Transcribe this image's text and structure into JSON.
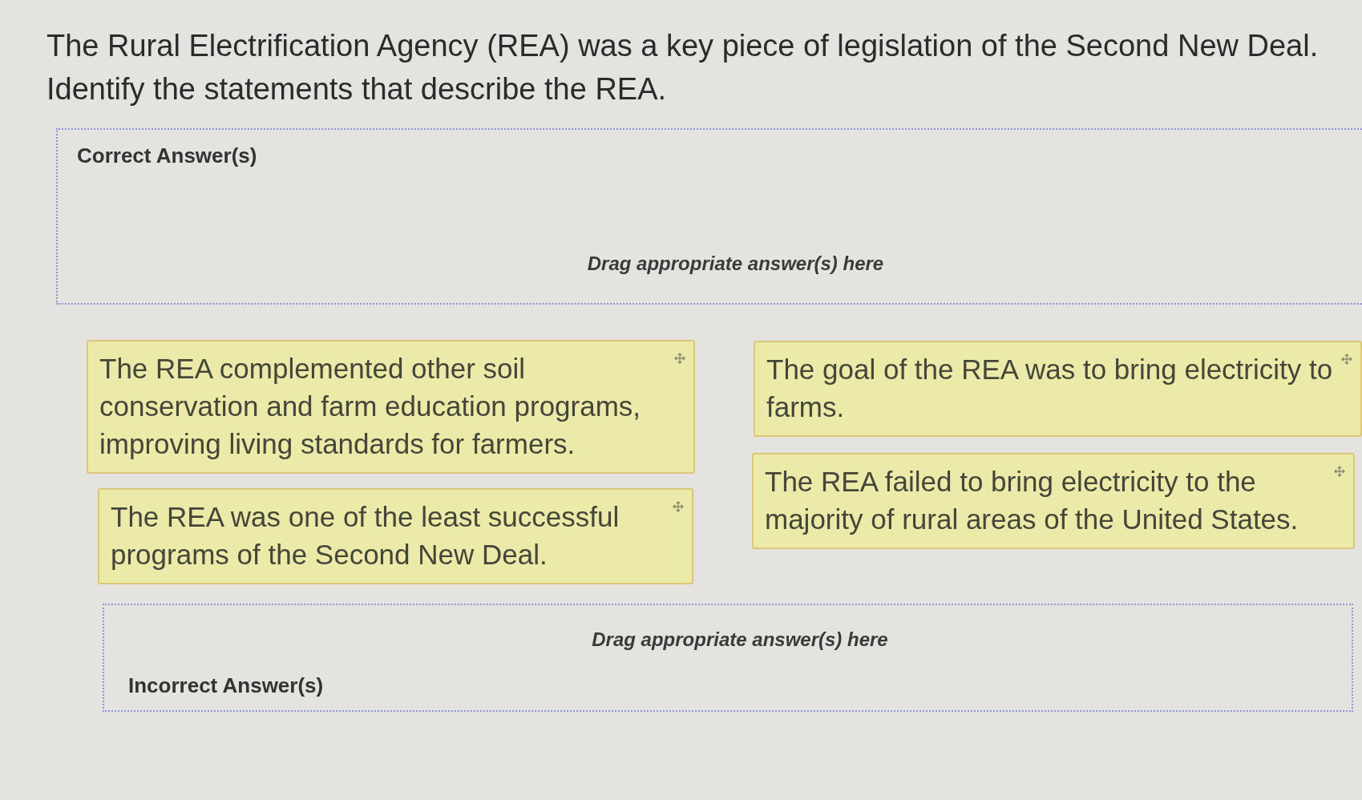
{
  "question": {
    "lines": [
      "The Rural Electrification Agency (REA) was a key piece of legislation of the Second New Deal.",
      "Identify the statements that describe the REA."
    ]
  },
  "correct_zone": {
    "label": "Correct Answer(s)",
    "hint": "Drag appropriate answer(s) here"
  },
  "card_columns": [
    {
      "cards": [
        {
          "text": "The REA complemented other soil conservation and farm education programs, improving living standards for farmers."
        },
        {
          "text": "The REA was one of the least successful programs of the Second New Deal."
        }
      ]
    },
    {
      "cards": [
        {
          "text": "The goal of the REA was to bring electricity to farms."
        },
        {
          "text": "The REA failed to bring electricity to the majority of rural areas of the United States."
        }
      ]
    }
  ],
  "incorrect_zone": {
    "hint": "Drag appropriate answer(s) here",
    "label": "Incorrect Answer(s)"
  }
}
